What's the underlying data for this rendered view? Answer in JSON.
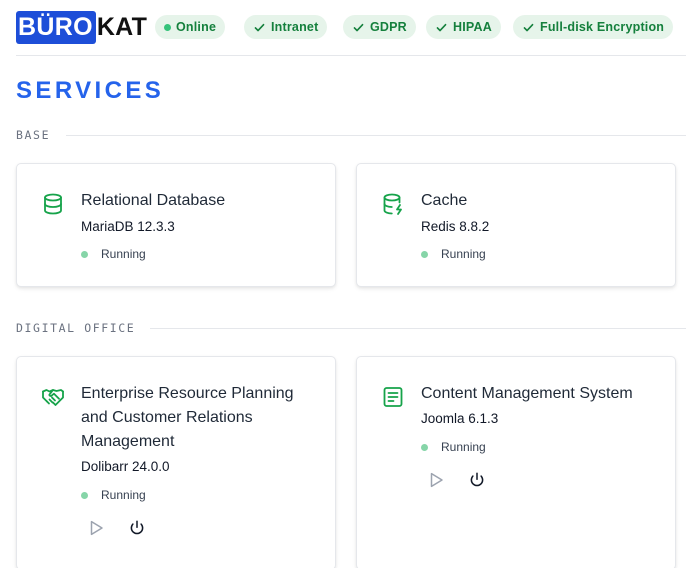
{
  "header": {
    "logo_part1": "BÜRO",
    "logo_part2": "KAT",
    "badges": [
      {
        "label": "Online",
        "icon": "status-dot"
      },
      {
        "label": "Intranet",
        "icon": "check-icon"
      },
      {
        "label": "GDPR",
        "icon": "check-icon"
      },
      {
        "label": "HIPAA",
        "icon": "check-icon"
      },
      {
        "label": "Full-disk Encryption",
        "icon": "check-icon"
      }
    ]
  },
  "page": {
    "title": "SERVICES"
  },
  "sections": [
    {
      "label": "BASE",
      "cards": [
        {
          "title": "Relational Database",
          "version": "MariaDB 12.3.3",
          "status": "Running",
          "icon": "database-icon"
        },
        {
          "title": "Cache",
          "version": "Redis 8.8.2",
          "status": "Running",
          "icon": "database-bolt-icon"
        }
      ]
    },
    {
      "label": "DIGITAL OFFICE",
      "cards": [
        {
          "title": "Enterprise Resource Planning and Customer Relations Management",
          "version": "Dolibarr 24.0.0",
          "status": "Running",
          "icon": "handshake-icon"
        },
        {
          "title": "Content Management System",
          "version": "Joomla 6.1.3",
          "status": "Running",
          "icon": "document-icon"
        }
      ]
    }
  ],
  "colors": {
    "accent": "#2563eb",
    "logo_bg": "#1d4ed8",
    "badge_bg": "#e6f4ea",
    "badge_text": "#15803d",
    "icon_green": "#16a34a",
    "status_dot": "#86d5a8"
  }
}
